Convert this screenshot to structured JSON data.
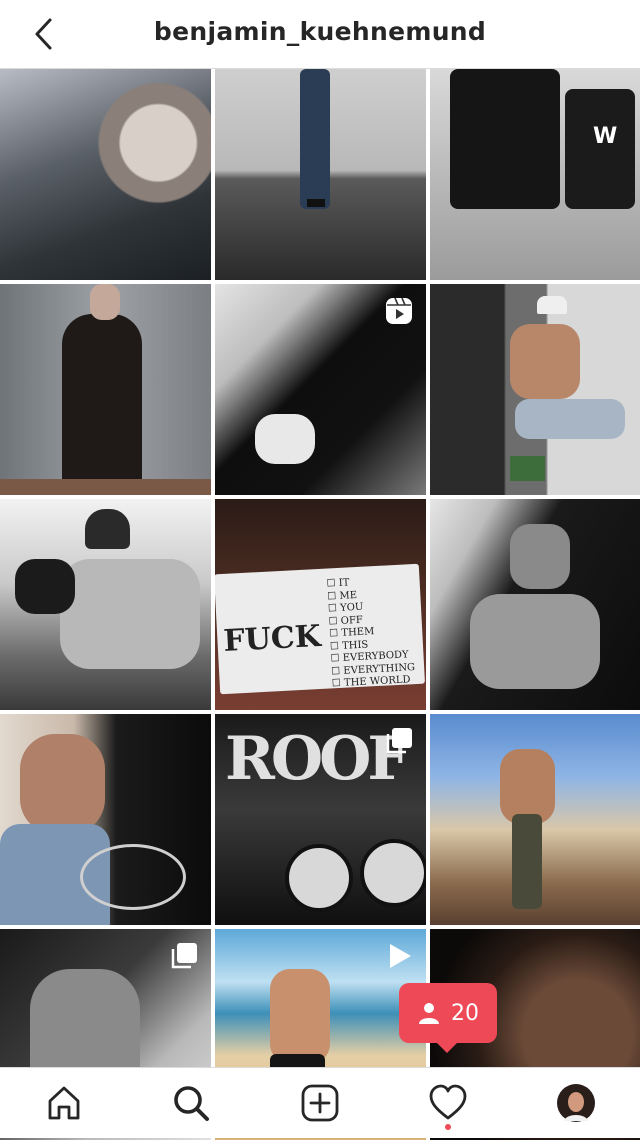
{
  "header": {
    "username": "benjamin_kuehnemund"
  },
  "grid": {
    "posts": [
      {
        "name": "post-1",
        "badge": null
      },
      {
        "name": "post-2",
        "badge": null
      },
      {
        "name": "post-3",
        "badge": null
      },
      {
        "name": "post-4",
        "badge": null
      },
      {
        "name": "post-5",
        "badge": "reels-icon"
      },
      {
        "name": "post-6",
        "badge": null
      },
      {
        "name": "post-7",
        "badge": null
      },
      {
        "name": "post-8",
        "badge": null
      },
      {
        "name": "post-9",
        "badge": null
      },
      {
        "name": "post-10",
        "badge": null
      },
      {
        "name": "post-11",
        "badge": "carousel-icon"
      },
      {
        "name": "post-12",
        "badge": null
      },
      {
        "name": "post-13",
        "badge": "carousel-icon"
      },
      {
        "name": "post-14",
        "badge": "video-icon"
      },
      {
        "name": "post-15",
        "badge": null
      }
    ],
    "card_text": {
      "headline": "FUCK",
      "options": [
        "IT",
        "ME",
        "YOU",
        "OFF",
        "THEM",
        "THIS",
        "EVERYBODY",
        "EVERYTHING",
        "THE WORLD"
      ]
    }
  },
  "notification": {
    "icon": "person-icon",
    "count": "20"
  },
  "bottom_nav": {
    "items": [
      "home-icon",
      "search-icon",
      "new-post-icon",
      "activity-heart-icon",
      "profile-avatar"
    ]
  },
  "colors": {
    "accent": "#ed4956",
    "text": "#262626",
    "border": "#dbdbdb"
  }
}
